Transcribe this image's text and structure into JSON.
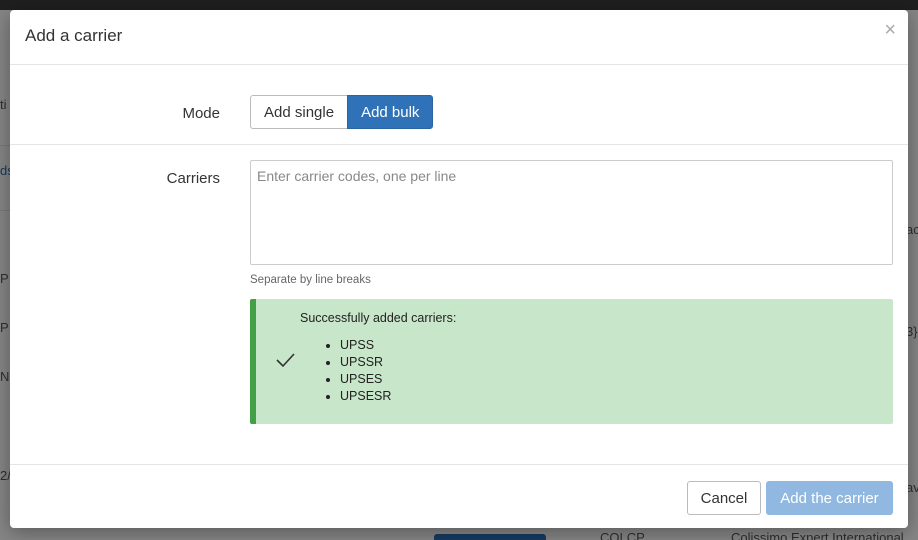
{
  "background": {
    "fragments": [
      "ti",
      "ds",
      "ac",
      "P",
      "P",
      "N",
      "3}",
      "2/",
      "av",
      "COLCP",
      "Colissimo Expert International"
    ]
  },
  "modal": {
    "title": "Add a carrier",
    "close_symbol": "×",
    "mode": {
      "label": "Mode",
      "options": [
        "Add single",
        "Add bulk"
      ],
      "selected": "Add bulk"
    },
    "carriers": {
      "label": "Carriers",
      "value": "",
      "placeholder": "Enter carrier codes, one per line",
      "help": "Separate by line breaks"
    },
    "alert": {
      "icon": "check-icon",
      "title": "Successfully added carriers:",
      "items": [
        "UPSS",
        "UPSSR",
        "UPSES",
        "UPSESR"
      ],
      "color": "#c8e6c9",
      "accent": "#43a047"
    },
    "footer": {
      "cancel_label": "Cancel",
      "submit_label": "Add the carrier"
    }
  }
}
